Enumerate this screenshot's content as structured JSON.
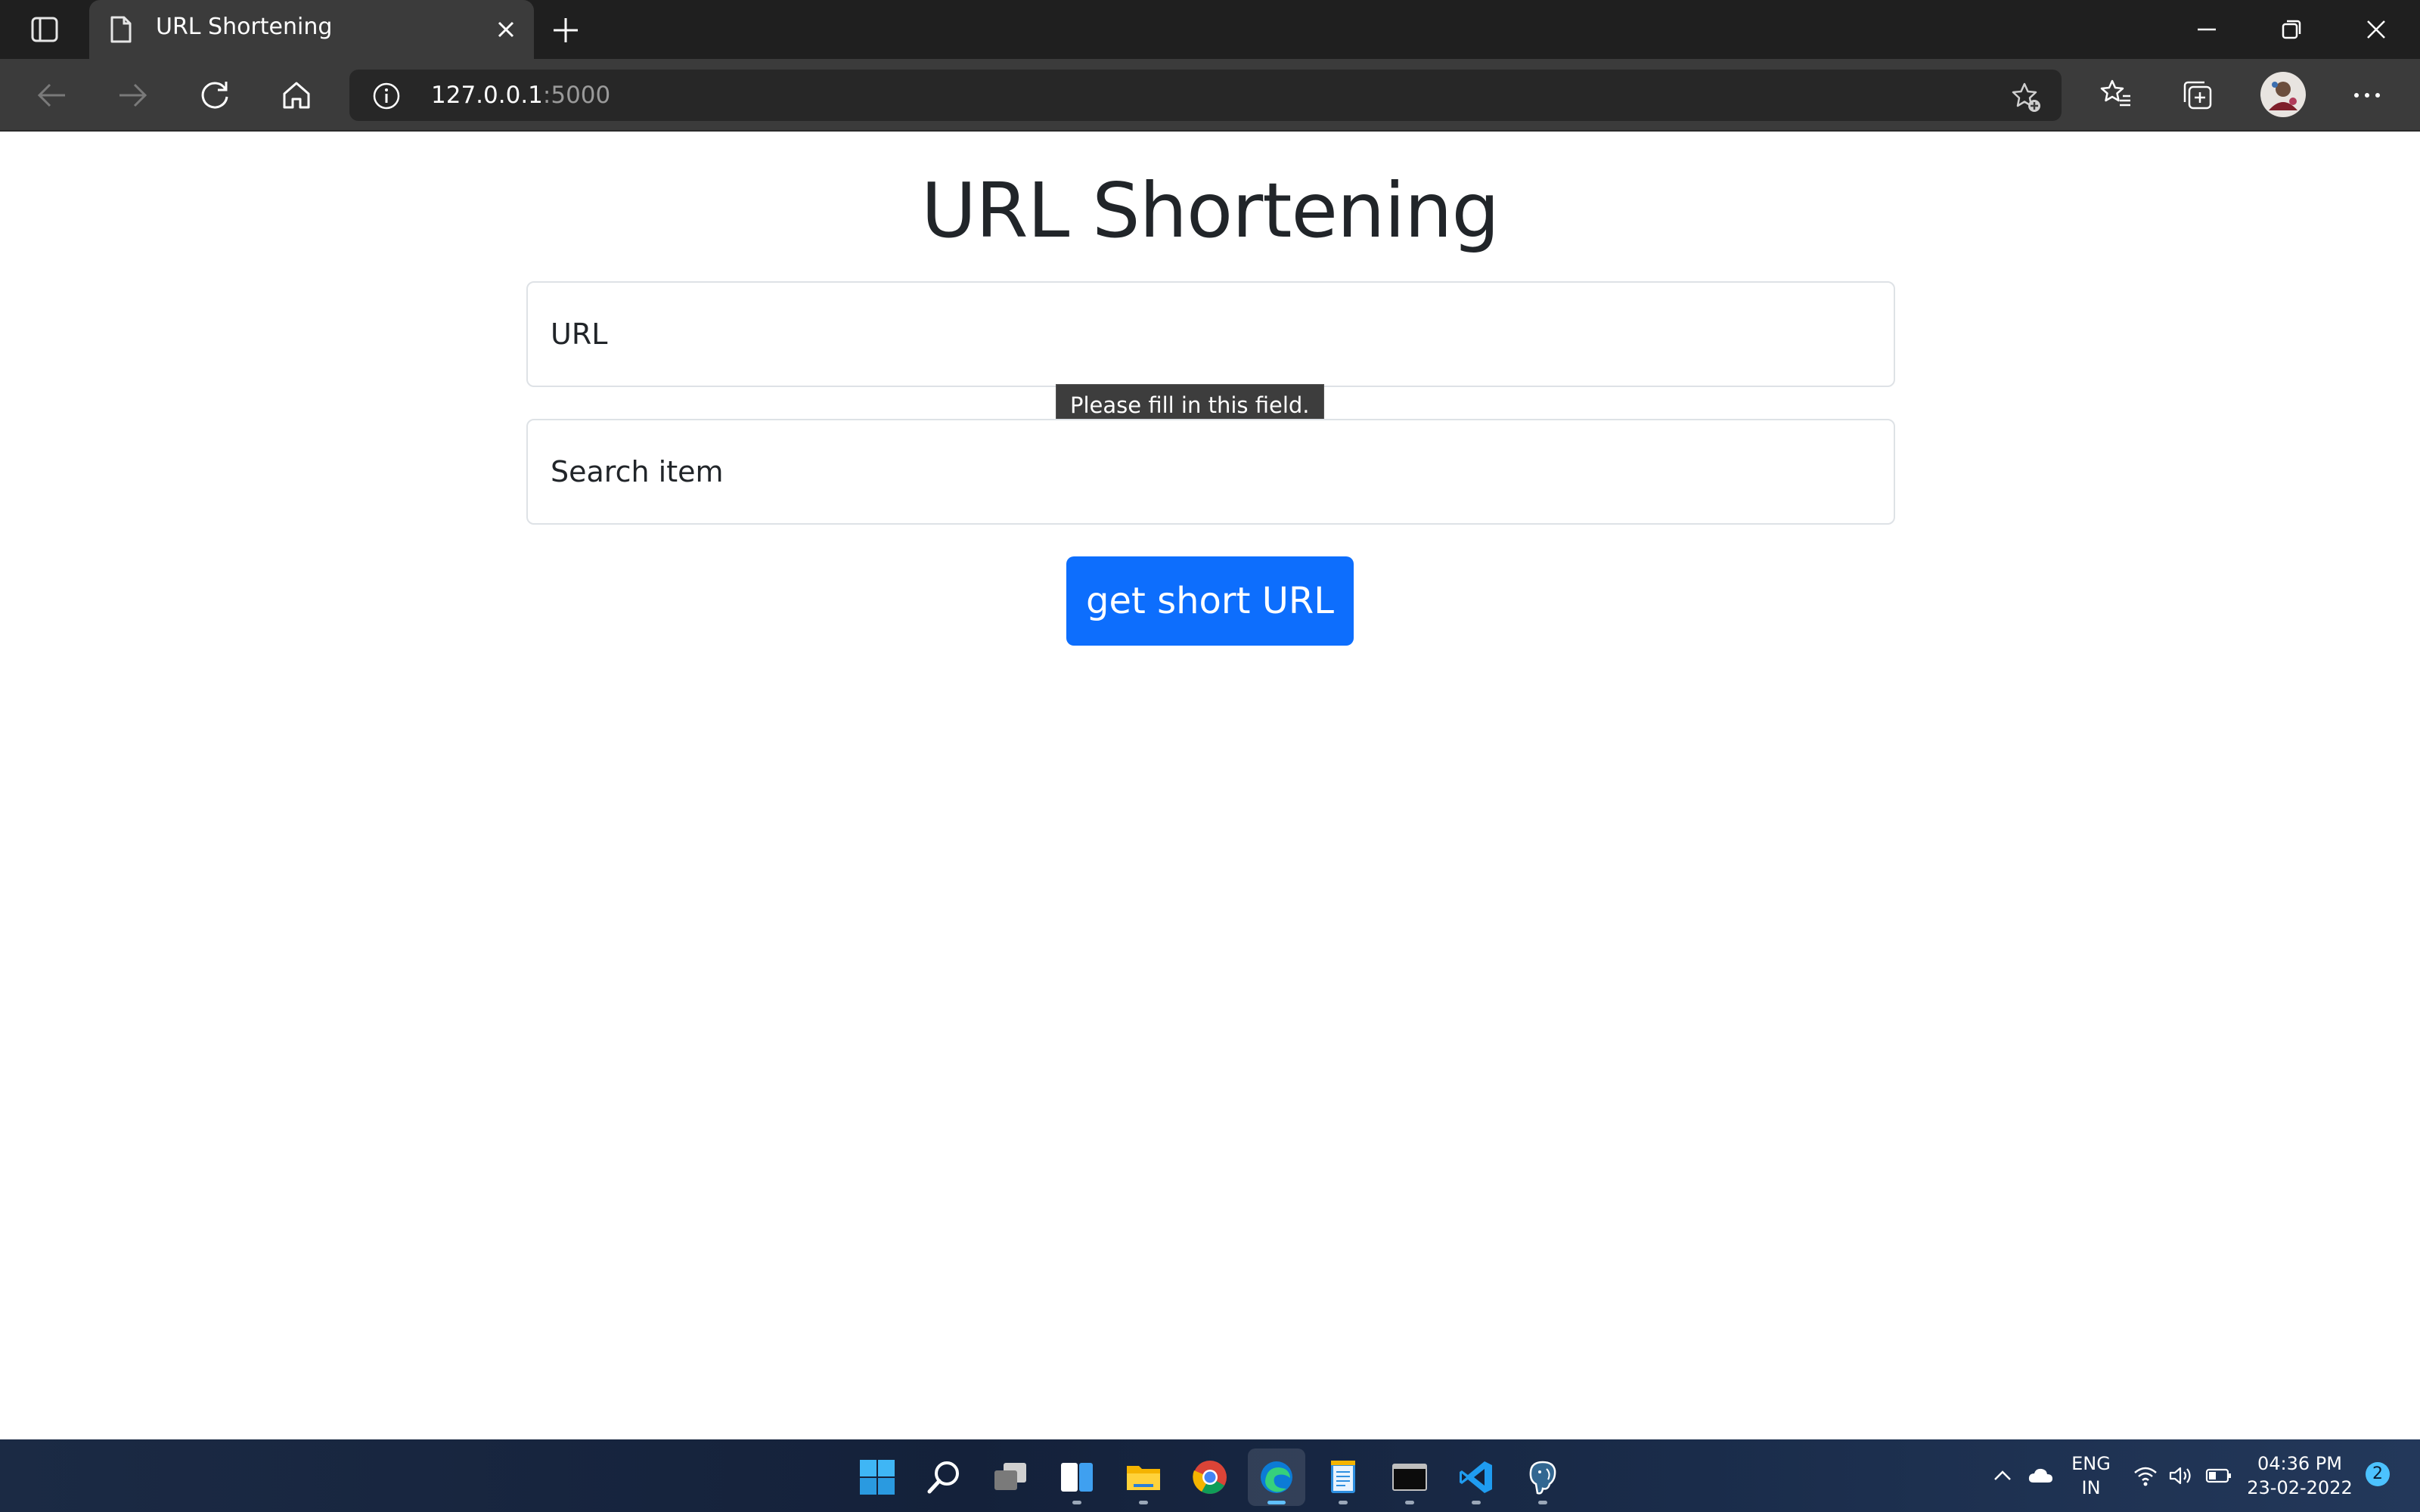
{
  "browser": {
    "tab": {
      "title": "URL Shortening",
      "page_icon": "document-icon"
    },
    "address": {
      "host": "127.0.0.1",
      "port": ":5000"
    },
    "icons": [
      "tab-actions-icon",
      "close-icon",
      "plus-icon",
      "minimize-icon",
      "restore-icon",
      "close-window-icon",
      "back-icon",
      "forward-icon",
      "refresh-icon",
      "home-icon",
      "info-icon",
      "add-favorite-icon",
      "favorites-icon",
      "collections-icon",
      "profile-avatar",
      "more-icon"
    ]
  },
  "page": {
    "title": "URL Shortening",
    "url_field": {
      "placeholder": "URL"
    },
    "search_field": {
      "placeholder": "Search item"
    },
    "validation_tooltip": "Please fill in this field.",
    "submit_label": "get short URL"
  },
  "taskbar": {
    "apps": [
      "start-icon",
      "search-icon",
      "task-view-icon",
      "widgets-icon",
      "file-explorer-icon",
      "chrome-icon",
      "edge-icon",
      "notepad-icon",
      "terminal-icon",
      "vscode-icon",
      "postgresql-icon"
    ],
    "language": {
      "line1": "ENG",
      "line2": "IN"
    },
    "clock": {
      "time": "04:36 PM",
      "date": "23-02-2022"
    },
    "notifications": "2"
  },
  "colors": {
    "accent": "#0d6efd",
    "chrome_dark": "#1f1f1f",
    "toolbar": "#3b3b3b"
  }
}
